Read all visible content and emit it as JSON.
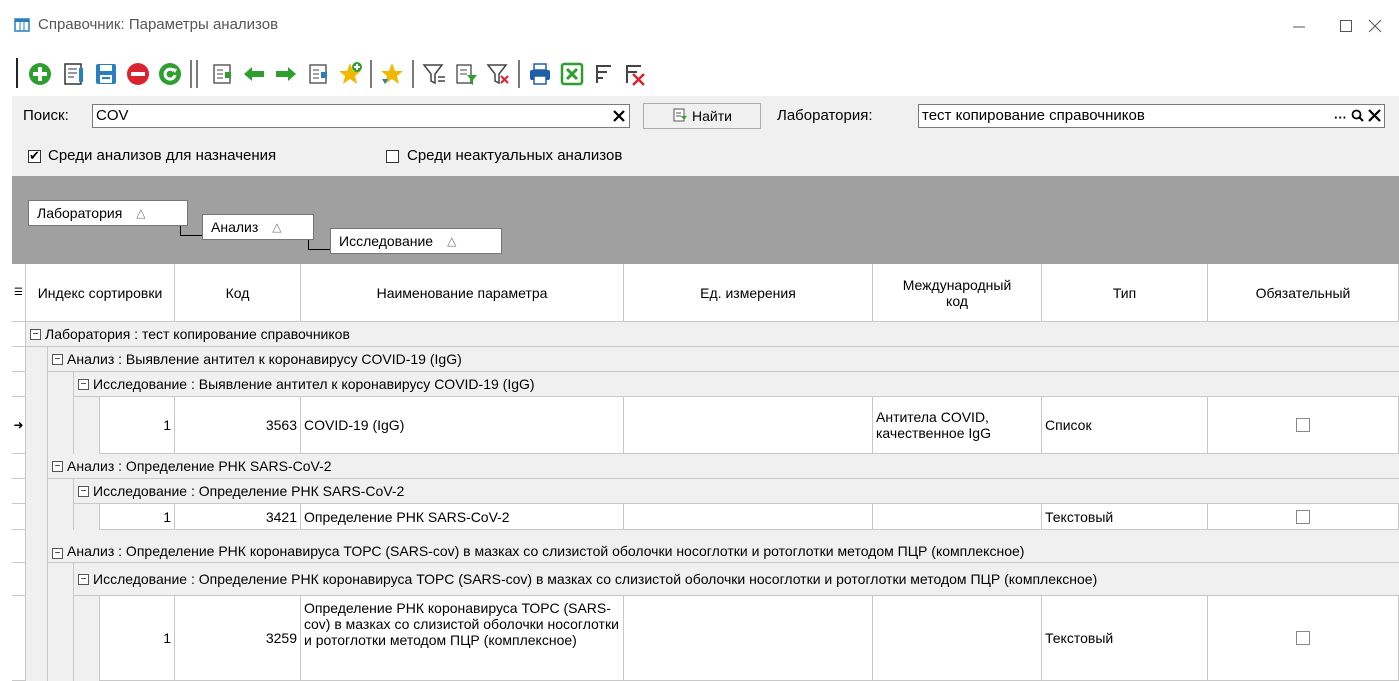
{
  "window": {
    "title": "Справочник: Параметры анализов"
  },
  "search": {
    "label": "Поиск:",
    "value": "COV",
    "find_label": "Найти",
    "lab_label": "Лаборатория:",
    "lab_value": "тест копирование справочников",
    "lab_ellipsis": "···",
    "only_prescribe_label": "Среди анализов для назначения",
    "only_prescribe_checked": true,
    "obsolete_label": "Среди неактуальных анализов",
    "obsolete_checked": false
  },
  "grouping": {
    "chips": [
      "Лаборатория",
      "Анализ",
      "Исследование"
    ]
  },
  "grid": {
    "columns": [
      "Индекс сортировки",
      "Код",
      "Наименование параметра",
      "Ед. измерения",
      "Международный код",
      "Тип",
      "Обязательный"
    ],
    "lab_group": "Лаборатория : тест копирование справочников",
    "analyses": [
      {
        "analysis": "Анализ : Выявление антител к коронавирусу COVID-19 (IgG)",
        "study": "Исследование : Выявление антител к коронавирусу COVID-19 (IgG)",
        "row": {
          "index": "1",
          "code": "3563",
          "name": "COVID-19 (IgG)",
          "unit": "",
          "intl_code": "Антитела COVID, качественное IgG",
          "type": "Список",
          "required": false
        }
      },
      {
        "analysis": "Анализ : Определение РНК SARS-CoV-2",
        "study": "Исследование : Определение РНК SARS-CoV-2",
        "row": {
          "index": "1",
          "code": "3421",
          "name": "Определение РНК SARS-CoV-2",
          "unit": "",
          "intl_code": "",
          "type": "Текстовый",
          "required": false
        }
      },
      {
        "analysis": "Анализ : Определение РНК коронавируса ТОРС (SARS-cov) в мазках со слизистой оболочки носоглотки и ротоглотки методом ПЦР (комплексное)",
        "study": "Исследование : Определение РНК коронавируса ТОРС (SARS-cov) в мазках со слизистой оболочки носоглотки и ротоглотки методом ПЦР (комплексное)",
        "row": {
          "index": "1",
          "code": "3259",
          "name": "Определение РНК коронавируса ТОРС (SARS-cov) в мазках со слизистой оболочки носоглотки и ротоглотки методом ПЦР (комплексное)",
          "unit": "",
          "intl_code": "",
          "type": "Текстовый",
          "required": false
        }
      }
    ]
  },
  "colors": {
    "add": "#2e9e2e",
    "save": "#2a7fc0",
    "stop": "#d9232e",
    "arrow": "#2e9e2e",
    "star": "#f2b705",
    "print": "#1f5fa8",
    "excel": "#2e9e2e",
    "group_bg": "#a0a0a0"
  }
}
